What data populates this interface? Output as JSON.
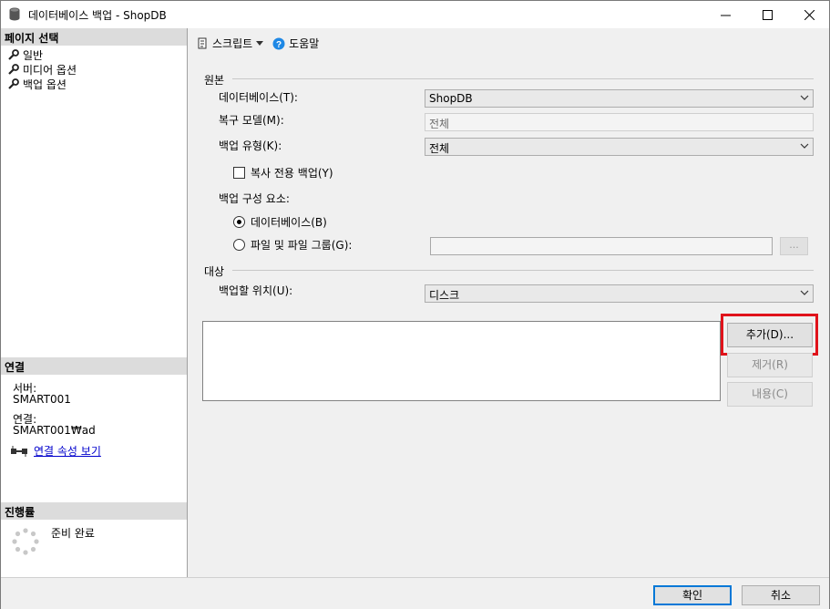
{
  "window": {
    "title": "데이터베이스 백업 - ShopDB"
  },
  "left": {
    "page_select_header": "페이지 선택",
    "nav_items": [
      "일반",
      "미디어 옵션",
      "백업 옵션"
    ],
    "connection_header": "연결",
    "server_label": "서버:",
    "server_value": "SMART001",
    "connection_label": "연결:",
    "connection_value": "SMART001₩ad",
    "view_conn_props": "연결 속성 보기",
    "progress_header": "진행률",
    "progress_status": "준비 완료"
  },
  "toolbar": {
    "script_label": "스크립트",
    "help_label": "도움말"
  },
  "source": {
    "group_label": "원본",
    "database_label": "데이터베이스(T):",
    "database_value": "ShopDB",
    "recovery_label": "복구 모델(M):",
    "recovery_value": "전체",
    "backup_type_label": "백업 유형(K):",
    "backup_type_value": "전체",
    "copy_only_label": "복사 전용 백업(Y)",
    "component_label": "백업 구성 요소:",
    "radio_database": "데이터베이스(B)",
    "radio_files": "파일 및 파일 그룹(G):",
    "browse_label": "..."
  },
  "destination": {
    "group_label": "대상",
    "backup_to_label": "백업할 위치(U):",
    "backup_to_value": "디스크",
    "add_button": "추가(D)...",
    "remove_button": "제거(R)",
    "contents_button": "내용(C)"
  },
  "footer": {
    "ok_button": "확인",
    "cancel_button": "취소"
  }
}
